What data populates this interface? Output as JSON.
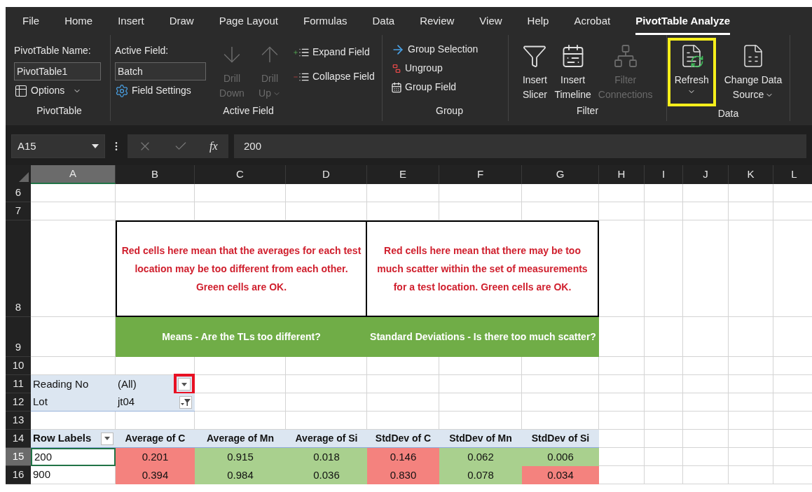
{
  "menu_tabs": [
    {
      "label": "File",
      "selected": false
    },
    {
      "label": "Home",
      "selected": false
    },
    {
      "label": "Insert",
      "selected": false
    },
    {
      "label": "Draw",
      "selected": false
    },
    {
      "label": "Page Layout",
      "selected": false
    },
    {
      "label": "Formulas",
      "selected": false
    },
    {
      "label": "Data",
      "selected": false
    },
    {
      "label": "Review",
      "selected": false
    },
    {
      "label": "View",
      "selected": false
    },
    {
      "label": "Help",
      "selected": false
    },
    {
      "label": "Acrobat",
      "selected": false
    },
    {
      "label": "PivotTable Analyze",
      "selected": true
    }
  ],
  "ribbon": {
    "pivottable": {
      "name_label": "PivotTable Name:",
      "name_value": "PivotTable1",
      "options": "Options",
      "group_label": "PivotTable"
    },
    "active_field": {
      "field_label": "Active Field:",
      "field_value": "Batch",
      "settings": "Field Settings",
      "drill": [
        {
          "lines": [
            "Drill",
            "Down"
          ],
          "kind": "down",
          "disabled": true,
          "dropdown": false
        },
        {
          "lines": [
            "Drill",
            "Up"
          ],
          "kind": "up",
          "disabled": true,
          "dropdown": true
        }
      ],
      "expand": "Expand Field",
      "collapse": "Collapse Field",
      "group_label": "Active Field"
    },
    "group": {
      "items": [
        {
          "label": "Group Selection",
          "kind": "selection"
        },
        {
          "label": "Ungroup",
          "kind": "ungroup"
        },
        {
          "label": "Group Field",
          "kind": "field"
        }
      ],
      "group_label": "Group"
    },
    "filter": {
      "buttons": [
        {
          "lines": [
            "Insert",
            "Slicer"
          ],
          "kind": "slicer",
          "disabled": false
        },
        {
          "lines": [
            "Insert",
            "Timeline"
          ],
          "kind": "timeline",
          "disabled": false
        },
        {
          "lines": [
            "Filter",
            "Connections"
          ],
          "kind": "connections",
          "disabled": true
        }
      ],
      "group_label": "Filter"
    },
    "data": {
      "buttons": [
        {
          "lines": [
            "Refresh"
          ],
          "kind": "refresh",
          "highlighted": true,
          "dropdown": true
        },
        {
          "lines": [
            "Change Data",
            "Source"
          ],
          "kind": "source",
          "highlighted": false,
          "dropdown": true
        }
      ],
      "group_label": "Data"
    }
  },
  "formula_bar": {
    "name_box": "A15",
    "function_button": "fx",
    "formula": "200"
  },
  "columns": [
    {
      "label": "A",
      "selected": true
    },
    {
      "label": "B",
      "selected": false
    },
    {
      "label": "C",
      "selected": false
    },
    {
      "label": "D",
      "selected": false
    },
    {
      "label": "E",
      "selected": false
    },
    {
      "label": "F",
      "selected": false
    },
    {
      "label": "G",
      "selected": false
    },
    {
      "label": "H",
      "selected": false
    },
    {
      "label": "I",
      "selected": false
    },
    {
      "label": "J",
      "selected": false
    },
    {
      "label": "K",
      "selected": false
    },
    {
      "label": "L",
      "selected": false
    }
  ],
  "rows": [
    {
      "number": "6",
      "kind": "empty",
      "selected": false
    },
    {
      "number": "7",
      "kind": "empty",
      "selected": false
    },
    {
      "number": "8",
      "kind": "notes",
      "selected": false,
      "notes": [
        "Red cells here mean that the averages for each test location may be too different from each other. Green cells are OK.",
        "Red cells here mean that there may be too much scatter within the set of measurements for a test location. Green cells are OK."
      ]
    },
    {
      "number": "9",
      "kind": "banner",
      "selected": false,
      "banners": [
        "Means - Are the TLs too different?",
        "Standard Deviations - Is there too much scatter?"
      ]
    },
    {
      "number": "10",
      "kind": "empty",
      "selected": false
    },
    {
      "number": "11",
      "kind": "filter",
      "selected": false,
      "label": "Reading No",
      "value": "(All)",
      "filtered": false,
      "highlighted": true
    },
    {
      "number": "12",
      "kind": "filter",
      "selected": false,
      "label": "Lot",
      "value": "jt04",
      "filtered": true,
      "highlighted": false
    },
    {
      "number": "13",
      "kind": "empty",
      "selected": false
    },
    {
      "number": "14",
      "kind": "header",
      "selected": false,
      "label": "Row Labels",
      "headers": [
        "Average of C",
        "Average of Mn",
        "Average of Si",
        "StdDev of C",
        "StdDev of Mn",
        "StdDev of Si"
      ]
    },
    {
      "number": "15",
      "kind": "data",
      "selected": true,
      "label": "200",
      "values": [
        {
          "text": "0.201",
          "color": "#f4827e"
        },
        {
          "text": "0.915",
          "color": "#a9d08e"
        },
        {
          "text": "0.018",
          "color": "#a9d08e"
        },
        {
          "text": "0.146",
          "color": "#f4827e"
        },
        {
          "text": "0.062",
          "color": "#a9d08e"
        },
        {
          "text": "0.006",
          "color": "#a9d08e"
        }
      ]
    },
    {
      "number": "16",
      "kind": "data",
      "selected": false,
      "label": "900",
      "values": [
        {
          "text": "0.394",
          "color": "#f4827e"
        },
        {
          "text": "0.984",
          "color": "#a9d08e"
        },
        {
          "text": "0.036",
          "color": "#a9d08e"
        },
        {
          "text": "0.830",
          "color": "#f4827e"
        },
        {
          "text": "0.078",
          "color": "#a9d08e"
        },
        {
          "text": "0.034",
          "color": "#f4827e"
        }
      ]
    }
  ]
}
